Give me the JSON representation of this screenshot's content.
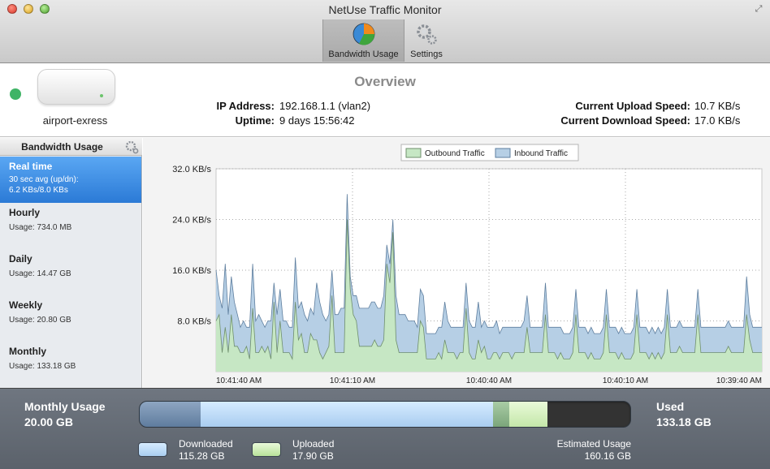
{
  "window": {
    "title": "NetUse Traffic Monitor"
  },
  "toolbar": {
    "bandwidth_label": "Bandwidth Usage",
    "settings_label": "Settings"
  },
  "overview": {
    "title": "Overview",
    "device_name": "airport-exress",
    "ip_label": "IP Address:",
    "ip_value": "192.168.1.1 (vlan2)",
    "uptime_label": "Uptime:",
    "uptime_value": "9 days 15:56:42",
    "upload_label": "Current Upload Speed:",
    "upload_value": "10.7 KB/s",
    "download_label": "Current Download Speed:",
    "download_value": "17.0 KB/s",
    "status_color": "#3fb466"
  },
  "sidebar": {
    "header": "Bandwidth Usage",
    "items": [
      {
        "title": "Real time",
        "line1": "30 sec avg (up/dn):",
        "line2": "6.2 KBs/8.0 KBs",
        "selected": true
      },
      {
        "title": "Hourly",
        "line1": "Usage: 734.0 MB"
      },
      {
        "title": "Daily",
        "line1": "Usage: 14.47 GB"
      },
      {
        "title": "Weekly",
        "line1": "Usage: 20.80 GB"
      },
      {
        "title": "Monthly",
        "line1": "Usage: 133.18 GB"
      }
    ]
  },
  "chart_data": {
    "type": "area",
    "legend_position": "top",
    "grid": true,
    "ylim": [
      0,
      32
    ],
    "y_ticks": [
      "32.0 KB/s",
      "24.0 KB/s",
      "16.0 KB/s",
      "8.0 KB/s"
    ],
    "y_tick_values": [
      32,
      24,
      16,
      8
    ],
    "x_ticks": [
      "10:41:40 AM",
      "10:41:10 AM",
      "10:40:40 AM",
      "10:40:10 AM",
      "10:39:40 AM"
    ],
    "colors": {
      "outbound": "#c6e7c4",
      "inbound": "#b6cfe5",
      "outbound_line": "#6f8f6d",
      "inbound_line": "#5f7f9f"
    },
    "series": [
      {
        "name": "Outbound Traffic",
        "values": [
          8,
          9,
          3,
          7,
          3,
          9,
          4,
          4,
          3,
          3,
          4,
          2,
          10,
          3,
          3,
          4,
          3,
          4,
          2,
          11,
          3,
          8,
          3,
          3,
          3,
          2,
          11,
          5,
          6,
          3,
          3,
          6,
          5,
          5,
          3,
          2,
          3,
          4,
          12,
          3,
          3,
          3,
          3,
          24,
          13,
          9,
          8,
          4,
          4,
          4,
          4,
          4,
          5,
          4,
          4,
          5,
          17,
          14,
          22,
          5,
          3,
          3,
          3,
          3,
          3,
          3,
          3,
          8,
          7,
          2,
          2,
          2,
          2,
          3,
          2,
          5,
          3,
          3,
          3,
          2,
          3,
          3,
          10,
          3,
          2,
          2,
          5,
          3,
          4,
          2,
          2,
          3,
          3,
          2,
          3,
          3,
          3,
          2,
          3,
          3,
          3,
          3,
          7,
          3,
          3,
          3,
          3,
          3,
          9,
          3,
          3,
          3,
          2,
          3,
          2,
          2,
          2,
          3,
          9,
          3,
          3,
          3,
          2,
          3,
          2,
          2,
          2,
          3,
          9,
          3,
          3,
          3,
          2,
          3,
          2,
          2,
          2,
          3,
          9,
          3,
          3,
          3,
          2,
          3,
          2,
          3,
          2,
          3,
          9,
          3,
          3,
          3,
          4,
          3,
          3,
          3,
          3,
          3,
          9,
          3,
          3,
          3,
          3,
          3,
          3,
          3,
          3,
          3,
          4,
          3,
          3,
          3,
          3,
          3,
          9,
          5,
          3,
          3,
          3,
          3
        ]
      },
      {
        "name": "Inbound Traffic",
        "values": [
          16,
          12,
          10,
          17,
          9,
          15,
          11,
          9,
          7,
          8,
          7,
          7,
          17,
          8,
          9,
          8,
          7,
          8,
          8,
          14,
          9,
          13,
          8,
          8,
          7,
          7,
          18,
          10,
          11,
          9,
          8,
          10,
          9,
          14,
          11,
          9,
          8,
          9,
          16,
          9,
          9,
          10,
          10,
          28,
          15,
          12,
          12,
          10,
          10,
          10,
          10,
          11,
          11,
          10,
          10,
          12,
          20,
          17,
          24,
          12,
          9,
          9,
          9,
          8,
          8,
          8,
          7,
          13,
          12,
          6,
          6,
          6,
          6,
          7,
          7,
          11,
          8,
          7,
          7,
          7,
          7,
          7,
          14,
          8,
          7,
          7,
          11,
          7,
          8,
          7,
          7,
          7,
          8,
          6,
          7,
          7,
          7,
          7,
          7,
          7,
          7,
          8,
          12,
          7,
          7,
          7,
          7,
          7,
          14,
          7,
          7,
          7,
          7,
          7,
          6,
          6,
          6,
          7,
          13,
          7,
          7,
          7,
          6,
          7,
          6,
          6,
          6,
          7,
          13,
          7,
          7,
          7,
          6,
          7,
          6,
          6,
          6,
          7,
          13,
          7,
          7,
          7,
          6,
          7,
          6,
          7,
          6,
          7,
          13,
          7,
          7,
          7,
          8,
          7,
          7,
          7,
          7,
          7,
          13,
          7,
          7,
          7,
          7,
          7,
          7,
          7,
          7,
          7,
          8,
          7,
          7,
          7,
          7,
          7,
          15,
          9,
          7,
          7,
          7,
          7
        ]
      }
    ]
  },
  "bottom": {
    "monthly_label": "Monthly Usage",
    "monthly_value": "20.00 GB",
    "used_label": "Used",
    "used_value": "133.18 GB",
    "downloaded_label": "Downloaded",
    "downloaded_value": "115.28 GB",
    "uploaded_label": "Uploaded",
    "uploaded_value": "17.90 GB",
    "estimated_label": "Estimated Usage",
    "estimated_value": "160.16 GB",
    "bar": {
      "monthly_gb": 20.0,
      "downloaded_gb": 115.28,
      "uploaded_gb": 17.9,
      "estimated_gb": 160.16
    }
  }
}
